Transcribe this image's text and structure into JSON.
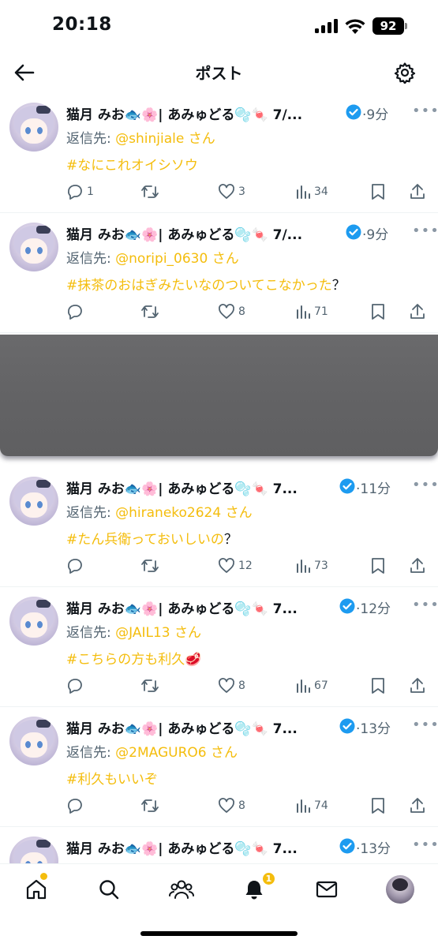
{
  "status_bar": {
    "time": "20:18",
    "battery": "92"
  },
  "header": {
    "title": "ポスト"
  },
  "colors": {
    "accent": "#f4bd0d",
    "verified": "#1d9bf0",
    "muted": "#536471"
  },
  "posts": [
    {
      "name": "猫月 みお🐟🌸| あみゅどる🫧🍬 7/...",
      "time": "·9分",
      "reply_label": "返信先: ",
      "reply_handle": "@shinjiale",
      "reply_suffix": " さん",
      "tag": "#なにこれオイシソウ",
      "tail": "",
      "replies": "1",
      "reposts": "",
      "likes": "3",
      "views": "34"
    },
    {
      "name": "猫月 みお🐟🌸| あみゅどる🫧🍬 7/...",
      "time": "·9分",
      "reply_label": "返信先: ",
      "reply_handle": "@noripi_0630",
      "reply_suffix": " さん",
      "tag": "#抹茶のおはぎみたいなのついてこなかった",
      "tail": "？",
      "replies": "",
      "reposts": "",
      "likes": "8",
      "views": "71"
    },
    {
      "name": "猫月 みお🐟🌸| あみゅどる🫧🍬 7...",
      "time": "·11分",
      "reply_label": "返信先: ",
      "reply_handle": "@hiraneko2624",
      "reply_suffix": " さん",
      "tag": "#たん兵衛っておいしいの",
      "tail": "？",
      "replies": "",
      "reposts": "",
      "likes": "12",
      "views": "73"
    },
    {
      "name": "猫月 みお🐟🌸| あみゅどる🫧🍬 7...",
      "time": "·12分",
      "reply_label": "返信先: ",
      "reply_handle": "@JAIL13",
      "reply_suffix": " さん",
      "tag": "#こちらの方も利久🥩",
      "tail": "",
      "replies": "",
      "reposts": "",
      "likes": "8",
      "views": "67"
    },
    {
      "name": "猫月 みお🐟🌸| あみゅどる🫧🍬 7...",
      "time": "·13分",
      "reply_label": "返信先: ",
      "reply_handle": "@2MAGURO6",
      "reply_suffix": " さん",
      "tag": "#利久もいいぞ",
      "tail": "",
      "replies": "",
      "reposts": "",
      "likes": "8",
      "views": "74"
    },
    {
      "name": "猫月 みお🐟🌸| あみゅどる🫧🍬 7...",
      "time": "·13分"
    }
  ],
  "bottom_nav": {
    "notification_count": "1"
  }
}
